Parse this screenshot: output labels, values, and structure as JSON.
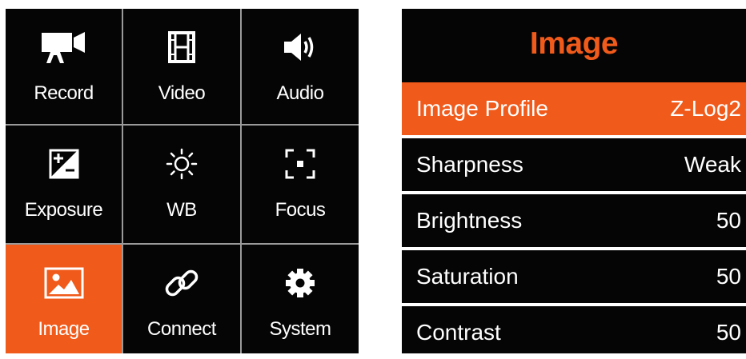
{
  "menu": {
    "items": [
      {
        "label": "Record",
        "icon": "camcorder-icon"
      },
      {
        "label": "Video",
        "icon": "film-icon"
      },
      {
        "label": "Audio",
        "icon": "speaker-icon"
      },
      {
        "label": "Exposure",
        "icon": "exposure-compensation-icon"
      },
      {
        "label": "WB",
        "icon": "sun-icon"
      },
      {
        "label": "Focus",
        "icon": "focus-frame-icon"
      },
      {
        "label": "Image",
        "icon": "picture-icon"
      },
      {
        "label": "Connect",
        "icon": "link-icon"
      },
      {
        "label": "System",
        "icon": "gear-icon"
      }
    ],
    "selected": "Image"
  },
  "panel": {
    "title": "Image",
    "rows": [
      {
        "name": "Image Profile",
        "value": "Z-Log2"
      },
      {
        "name": "Sharpness",
        "value": "Weak"
      },
      {
        "name": "Brightness",
        "value": "50"
      },
      {
        "name": "Saturation",
        "value": "50"
      },
      {
        "name": "Contrast",
        "value": "50"
      }
    ],
    "selected": "Image Profile"
  },
  "colors": {
    "accent": "#f05a1a",
    "background": "#050505",
    "divider": "#9a9a9a",
    "text": "#ffffff"
  }
}
